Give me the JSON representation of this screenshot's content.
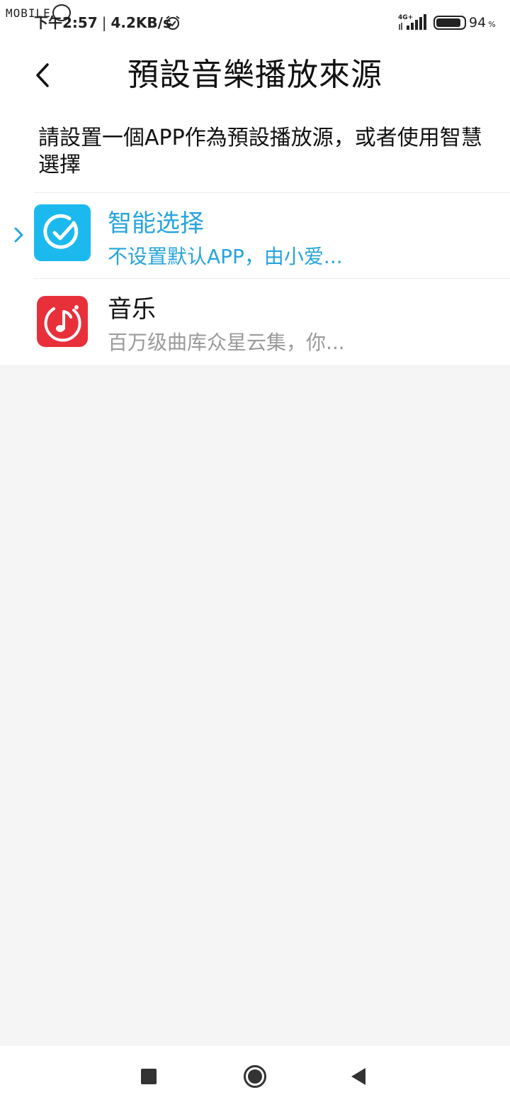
{
  "status_bar": {
    "watermark": "MOBILE",
    "time": "下午2:57",
    "net_speed": "4.2KB/s",
    "network_type": "4G+",
    "battery_value": "94",
    "battery_unit": "%"
  },
  "header": {
    "title": "預設音樂播放來源"
  },
  "description": "請設置一個APP作為預設播放源，或者使用智慧選擇",
  "apps": [
    {
      "title": "智能选择",
      "subtitle": "不设置默认APP，由小爱...",
      "selected": true,
      "icon": "check-circle-icon"
    },
    {
      "title": "音乐",
      "subtitle": "百万级曲库众星云集，你...",
      "selected": false,
      "icon": "music-note-icon"
    }
  ],
  "colors": {
    "accent": "#26a4dd",
    "smart_icon_bg": "#1cb9ee",
    "music_icon_bg": "#e8303a",
    "background": "#f5f5f5"
  },
  "icons": {
    "back": "chevron-left-icon",
    "selected_marker": "chevron-right-icon",
    "nav_recents": "square-icon",
    "nav_home": "circle-icon",
    "nav_back": "triangle-left-icon"
  }
}
